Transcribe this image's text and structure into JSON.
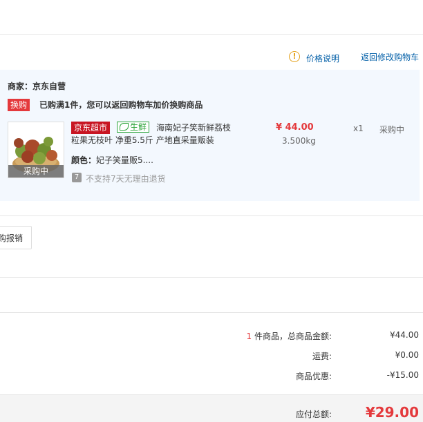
{
  "links": {
    "price_note": "价格说明",
    "back_to_cart": "返回修改购物车"
  },
  "order": {
    "merchant_label": "商家：京东自营",
    "promo_tag": "换购",
    "promo_text": "已购满1件，您可以返回购物车加价换购商品",
    "item": {
      "thumb_status": "采购中",
      "badge_supermarket": "京东超市",
      "badge_fresh": "生鲜",
      "title_line1": "海南妃子笑新鲜荔枝",
      "title_line2": "粒果无枝叶 净重5.5斤 产地直采量贩装",
      "price": "¥ 44.00",
      "weight": "3.500kg",
      "quantity": "x1",
      "status": "采购中",
      "color_label": "颜色：",
      "color_value": "妃子笑量贩5....",
      "return_icon": "7",
      "return_policy": "不支持7天无理由退货"
    }
  },
  "invoice_button": "购报销",
  "summary": {
    "count": "1",
    "items_label": " 件商品，总商品金额:",
    "items_value": "¥44.00",
    "shipping_label": "运费:",
    "shipping_value": "¥0.00",
    "discount_label": "商品优惠:",
    "discount_value": "-¥15.00",
    "payable_label": "应付总额:",
    "payable_value": "¥29.00"
  },
  "colors": {
    "accent_red": "#e4393c",
    "link_blue": "#005ea7",
    "fresh_green": "#2ca43a",
    "panel_bg": "#f3f8fe"
  }
}
